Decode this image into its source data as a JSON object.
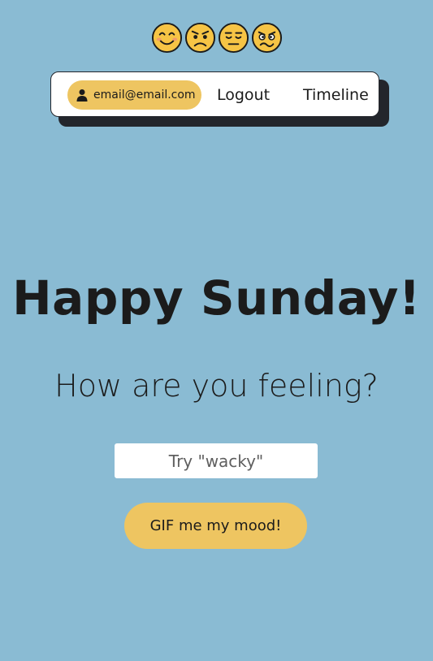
{
  "emojis": [
    {
      "icon": "smiling-face-icon"
    },
    {
      "icon": "sad-face-icon"
    },
    {
      "icon": "tired-face-icon"
    },
    {
      "icon": "confused-face-icon"
    }
  ],
  "nav": {
    "user_email": "email@email.com",
    "user_icon": "user-icon",
    "logout_label": "Logout",
    "timeline_label": "Timeline"
  },
  "main": {
    "greeting": "Happy Sunday!",
    "question": "How are you feeling?",
    "mood_input": {
      "value": "",
      "placeholder": "Try \"wacky\""
    },
    "submit_label": "GIF me my mood!"
  },
  "colors": {
    "background": "#8abbd3",
    "accent": "#eec561",
    "nav_shadow": "#23262c",
    "text": "#1b1b1b"
  }
}
